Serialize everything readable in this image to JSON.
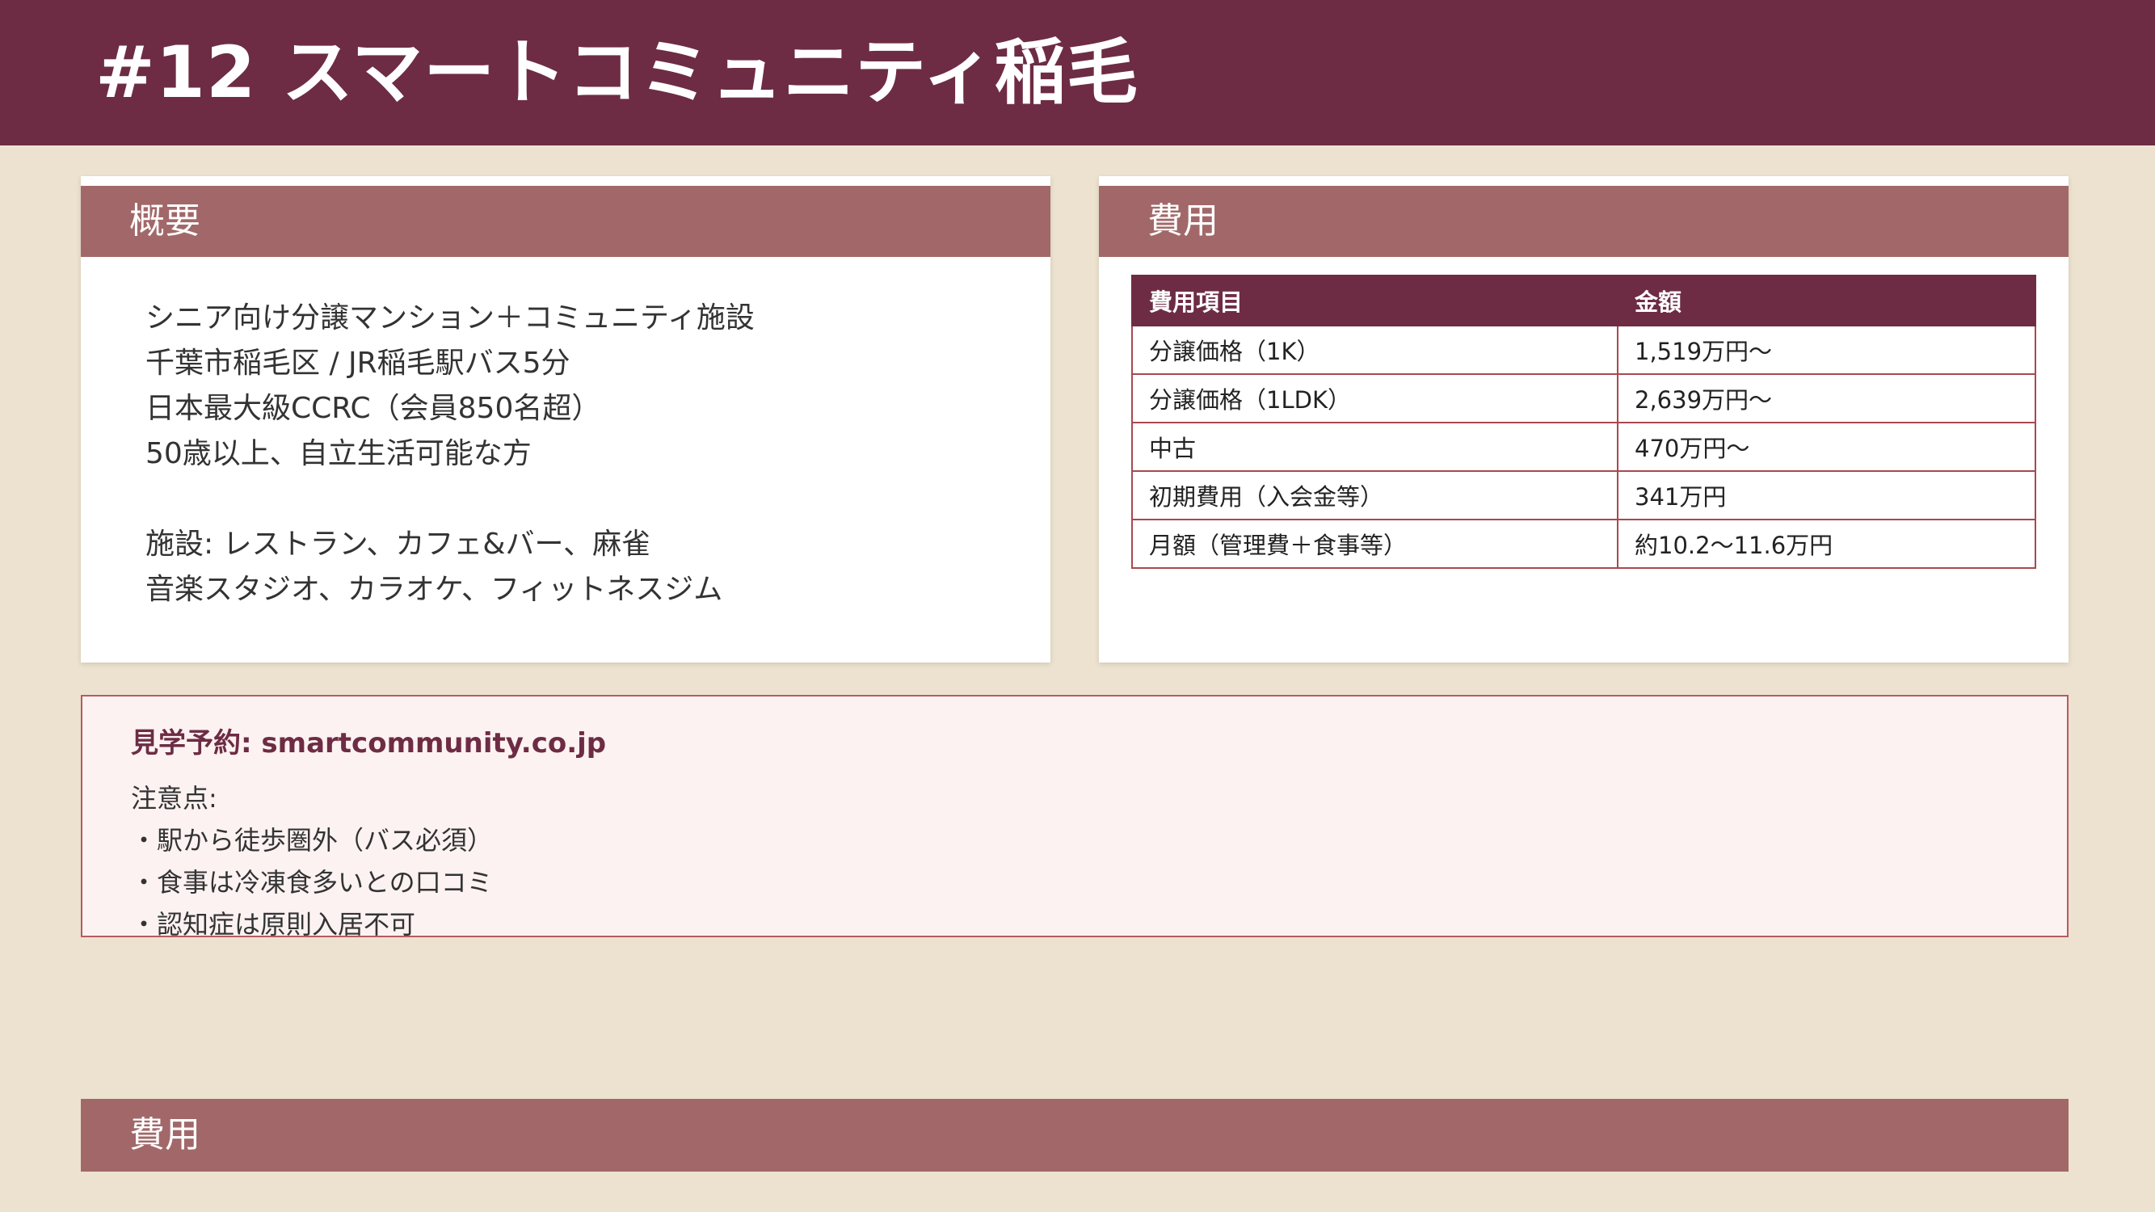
{
  "page": {
    "title": "#12 スマートコミュニティ稲毛"
  },
  "overview": {
    "heading": "概要",
    "lines": [
      "シニア向け分譲マンション＋コミュニティ施設",
      "千葉市稲毛区 / JR稲毛駅バス5分",
      "日本最大級CCRC（会員850名超）",
      "50歳以上、自立生活可能な方",
      "施設: レストラン、カフェ&バー、麻雀",
      "音楽スタジオ、カラオケ、フィットネスジム"
    ]
  },
  "costs": {
    "heading": "費用",
    "columns": [
      "費用項目",
      "金額"
    ],
    "rows": [
      [
        "分譲価格（1K）",
        "1,519万円〜"
      ],
      [
        "分譲価格（1LDK）",
        "2,639万円〜"
      ],
      [
        "中古",
        "470万円〜"
      ],
      [
        "初期費用（入会金等）",
        "341万円"
      ],
      [
        "月額（管理費＋食事等）",
        "約10.2〜11.6万円"
      ]
    ]
  },
  "notice": {
    "reservation": "見学予約: smartcommunity.co.jp",
    "notes_label": "注意点:",
    "notes": [
      "・駅から徒歩圏外（バス必須）",
      "・食事は冷凍食多いとの口コミ",
      "・認知症は原則入居不可"
    ]
  },
  "footer": {
    "heading": "費用"
  },
  "colors": {
    "header_bg": "#6d2c44",
    "section_bar": "#a26869",
    "background": "#ece2cf",
    "notice_bg": "#fdf2f2"
  }
}
